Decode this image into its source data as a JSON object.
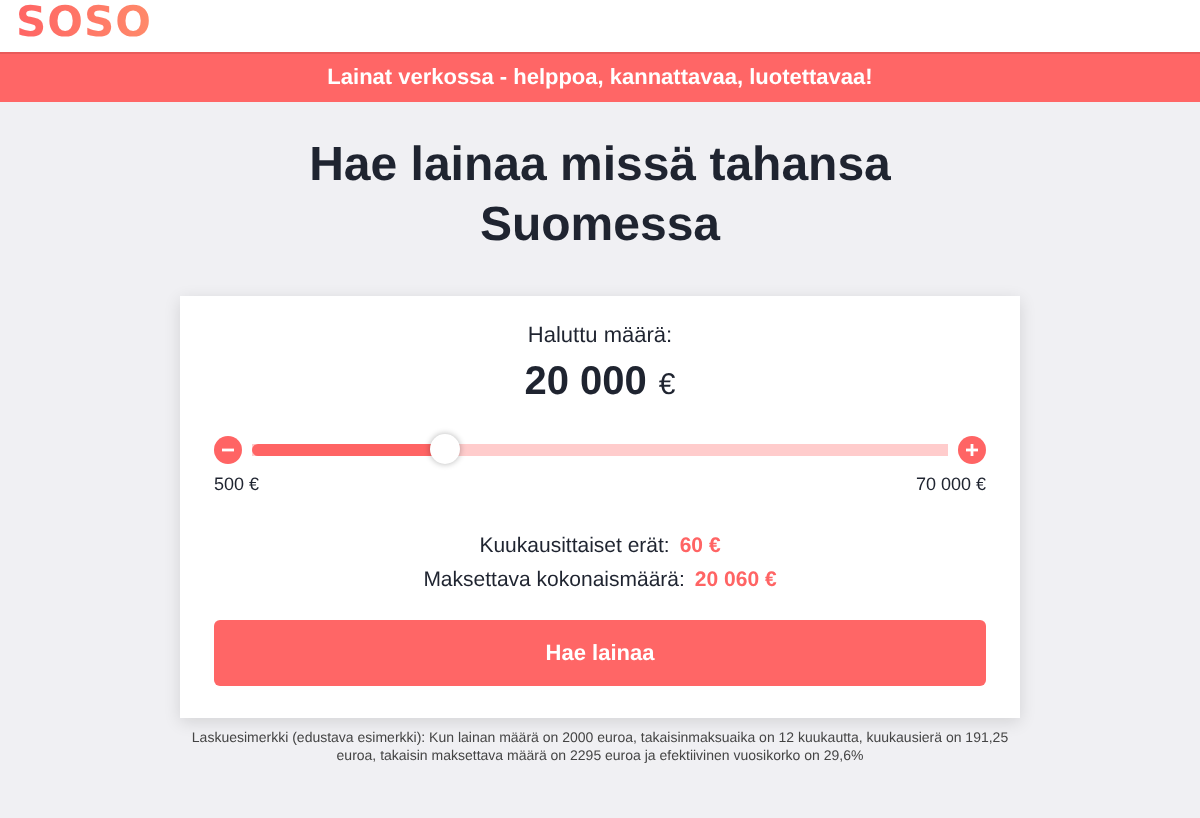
{
  "logo": "SOSO",
  "banner": "Lainat verkossa - helppoa, kannattavaa, luotettavaa!",
  "title": "Hae lainaa missä tahansa Suomessa",
  "calculator": {
    "amount_label": "Haluttu määrä:",
    "amount": "20 000",
    "amount_unit": "€",
    "slider": {
      "level": 0.28,
      "min_label": "500 €",
      "max_label": "70 000 €"
    },
    "results": [
      {
        "label": "Kuukausittaiset erät:",
        "value": "60 €"
      },
      {
        "label": "Maksettava kokonaismäärä:",
        "value": "20 060 €"
      }
    ],
    "button": "Hae lainaa"
  },
  "footnote": "Laskuesimerkki (edustava esimerkki): Kun lainan määrä on 2000 euroa, takaisinmaksuaika on 12 kuukautta, kuukausierä on 191,25 euroa, takaisin maksettava määrä on 2295 euroa ja efektiivinen vuosikorko on 29,6%"
}
